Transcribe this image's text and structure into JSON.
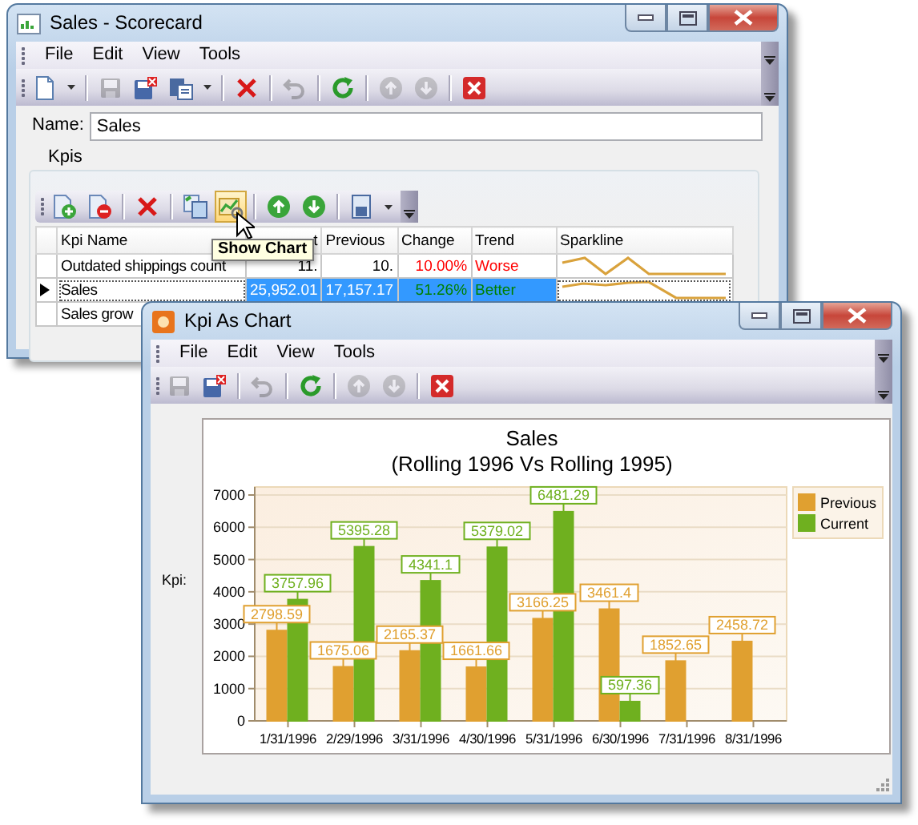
{
  "back_window": {
    "title": "Sales - Scorecard",
    "menu": [
      "File",
      "Edit",
      "View",
      "Tools"
    ],
    "toolbar": [
      {
        "kind": "new",
        "disabled": false
      },
      {
        "kind": "dropdown",
        "disabled": false
      },
      {
        "kind": "separator",
        "disabled": false
      },
      {
        "kind": "save",
        "disabled": true
      },
      {
        "kind": "save-close",
        "disabled": false
      },
      {
        "kind": "paste",
        "disabled": false
      },
      {
        "kind": "dropdown",
        "disabled": false
      },
      {
        "kind": "separator",
        "disabled": false
      },
      {
        "kind": "delete",
        "disabled": false
      },
      {
        "kind": "separator",
        "disabled": false
      },
      {
        "kind": "undo",
        "disabled": true
      },
      {
        "kind": "separator",
        "disabled": false
      },
      {
        "kind": "refresh",
        "disabled": false
      },
      {
        "kind": "separator",
        "disabled": false
      },
      {
        "kind": "up",
        "disabled": true
      },
      {
        "kind": "down",
        "disabled": true
      },
      {
        "kind": "separator",
        "disabled": false
      },
      {
        "kind": "close",
        "disabled": false
      }
    ],
    "name_label": "Name:",
    "name_value": "Sales",
    "group_label": "Kpis",
    "grid_toolbar": [
      {
        "kind": "add",
        "highlighted": false
      },
      {
        "kind": "remove",
        "highlighted": false
      },
      {
        "kind": "separator",
        "highlighted": false
      },
      {
        "kind": "delete",
        "highlighted": false
      },
      {
        "kind": "separator",
        "highlighted": false
      },
      {
        "kind": "copy",
        "highlighted": false
      },
      {
        "kind": "chart",
        "highlighted": true
      },
      {
        "kind": "separator",
        "highlighted": false
      },
      {
        "kind": "up",
        "highlighted": false
      },
      {
        "kind": "down",
        "highlighted": false
      },
      {
        "kind": "separator",
        "highlighted": false
      },
      {
        "kind": "export",
        "highlighted": false
      },
      {
        "kind": "dropdown",
        "highlighted": false
      }
    ],
    "tooltip": "Show Chart",
    "columns": [
      "Kpi Name",
      "t",
      "Previous",
      "Change",
      "Trend",
      "Sparkline"
    ],
    "rows": [
      {
        "name": "Outdated shippings count",
        "current": "11.",
        "previous": "10.",
        "change": "10.00%",
        "trend": "Worse",
        "color": "#ff0000",
        "selected": false
      },
      {
        "name": "Sales",
        "current": "25,952.01",
        "previous": "17,157.17",
        "change": "51.26%",
        "trend": "Better",
        "color": "#008000",
        "selected": true
      },
      {
        "name": "Sales grow",
        "selected": false
      }
    ]
  },
  "front_window": {
    "title": "Kpi As Chart",
    "menu": [
      "File",
      "Edit",
      "View",
      "Tools"
    ],
    "toolbar": [
      {
        "kind": "save",
        "disabled": true
      },
      {
        "kind": "save-close",
        "disabled": false
      },
      {
        "kind": "separator",
        "disabled": false
      },
      {
        "kind": "undo",
        "disabled": true
      },
      {
        "kind": "separator",
        "disabled": false
      },
      {
        "kind": "refresh",
        "disabled": false
      },
      {
        "kind": "separator",
        "disabled": false
      },
      {
        "kind": "up",
        "disabled": true
      },
      {
        "kind": "down",
        "disabled": true
      },
      {
        "kind": "separator",
        "disabled": false
      },
      {
        "kind": "close",
        "disabled": false
      }
    ],
    "kpi_label": "Kpi:",
    "chart_subtitle": "(Rolling 1996 Vs Rolling 1995)",
    "chart_data": {
      "type": "bar",
      "title": "Sales",
      "categories": [
        "1/31/1996",
        "2/29/1996",
        "3/31/1996",
        "4/30/1996",
        "5/31/1996",
        "6/30/1996",
        "7/31/1996",
        "8/31/1996"
      ],
      "series": [
        {
          "name": "Previous",
          "color": "#e0a030",
          "values": [
            2798.59,
            1675.06,
            2165.37,
            1661.66,
            3166.25,
            3461.4,
            1852.65,
            2458.72
          ]
        },
        {
          "name": "Current",
          "color": "#6fb01f",
          "values": [
            3757.96,
            5395.28,
            4341.1,
            5379.02,
            6481.29,
            597.36,
            null,
            null
          ]
        }
      ],
      "ylim": [
        0,
        7000
      ],
      "yticks": [
        0,
        1000,
        2000,
        3000,
        4000,
        5000,
        6000,
        7000
      ],
      "grid": true,
      "legend": "right",
      "data_labels": true
    }
  }
}
